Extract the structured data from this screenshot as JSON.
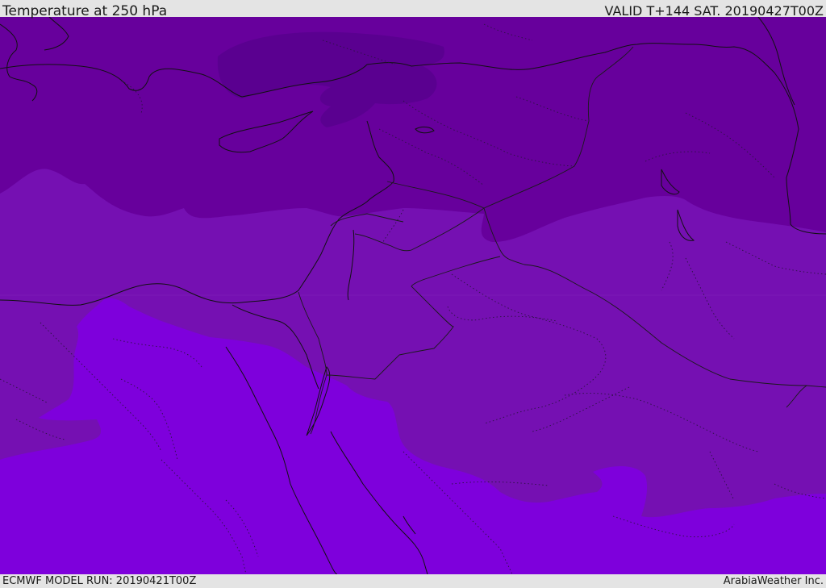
{
  "header": {
    "title": "Temperature at 250 hPa",
    "valid": "VALID T+144 SAT. 20190427T00Z"
  },
  "footer": {
    "model_run": "ECMWF MODEL RUN: 20190421T00Z",
    "credit": "ArabiaWeather Inc."
  },
  "map": {
    "variable": "Temperature at 250 hPa",
    "colors": {
      "band_darkest": "#5a0090",
      "band_dark": "#67009c",
      "band_mid": "#7510b2",
      "band_light": "#7e00dc",
      "coastline": "#111111",
      "border": "#1a1a1a"
    }
  }
}
